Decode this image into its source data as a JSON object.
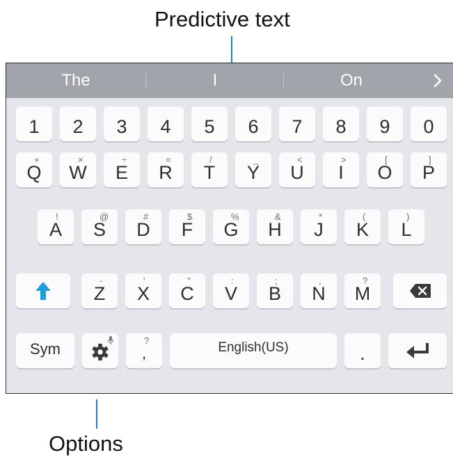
{
  "callouts": {
    "top": "Predictive text",
    "bottom": "Options"
  },
  "predictive_bar": {
    "suggestions": [
      "The",
      "I",
      "On"
    ],
    "more_icon": "chevron-right-icon"
  },
  "keyboard": {
    "number_row": [
      "1",
      "2",
      "3",
      "4",
      "5",
      "6",
      "7",
      "8",
      "9",
      "0"
    ],
    "row1": [
      {
        "key": "Q",
        "alt": "+"
      },
      {
        "key": "W",
        "alt": "×"
      },
      {
        "key": "E",
        "alt": "÷"
      },
      {
        "key": "R",
        "alt": "="
      },
      {
        "key": "T",
        "alt": "/"
      },
      {
        "key": "Y",
        "alt": "_"
      },
      {
        "key": "U",
        "alt": "<"
      },
      {
        "key": "I",
        "alt": ">"
      },
      {
        "key": "O",
        "alt": "["
      },
      {
        "key": "P",
        "alt": "]"
      }
    ],
    "row2": [
      {
        "key": "A",
        "alt": "!"
      },
      {
        "key": "S",
        "alt": "@"
      },
      {
        "key": "D",
        "alt": "#"
      },
      {
        "key": "F",
        "alt": "$"
      },
      {
        "key": "G",
        "alt": "%"
      },
      {
        "key": "H",
        "alt": "&"
      },
      {
        "key": "J",
        "alt": "*"
      },
      {
        "key": "K",
        "alt": "("
      },
      {
        "key": "L",
        "alt": ")"
      }
    ],
    "row3": [
      {
        "key": "Z",
        "alt": "-"
      },
      {
        "key": "X",
        "alt": "'"
      },
      {
        "key": "C",
        "alt": "\""
      },
      {
        "key": "V",
        "alt": ":"
      },
      {
        "key": "B",
        "alt": ";"
      },
      {
        "key": "N",
        "alt": ","
      },
      {
        "key": "M",
        "alt": "?"
      }
    ],
    "bottom_row": {
      "sym_label": "Sym",
      "options_icon": "gear-icon",
      "options_alt_icon": "microphone-icon",
      "comma_label": ",",
      "comma_alt": "?",
      "space_label": "English(US)",
      "period_label": ".",
      "enter_icon": "enter-icon"
    },
    "shift_icon": "shift-arrow-icon",
    "backspace_icon": "backspace-icon",
    "shift_color": "#1e9ee0"
  }
}
